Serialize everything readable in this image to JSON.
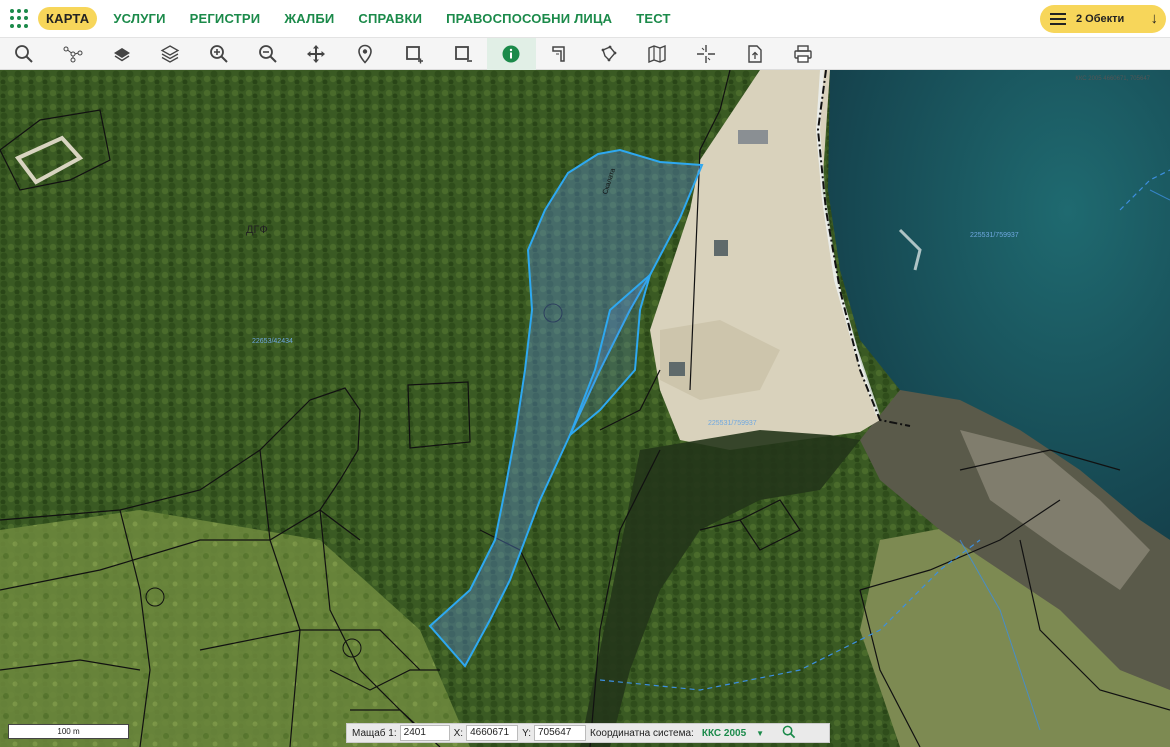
{
  "nav": {
    "items": [
      "КАРТА",
      "УСЛУГИ",
      "РЕГИСТРИ",
      "ЖАЛБИ",
      "СПРАВКИ",
      "ПРАВОСПОСОБНИ ЛИЦА",
      "ТЕСТ"
    ],
    "active_index": 0,
    "objects_label": "2 Обекти"
  },
  "toolbar": {
    "tools": [
      "search-icon",
      "measure-network-icon",
      "layer-icon",
      "layers-icon",
      "zoom-in-icon",
      "zoom-out-icon",
      "pan-icon",
      "location-pin-icon",
      "select-add-icon",
      "select-remove-icon",
      "info-icon",
      "bookmark-icon",
      "polygon-tool-icon",
      "map-icon",
      "crosshair-icon",
      "export-icon",
      "print-icon"
    ],
    "active_index": 10
  },
  "map": {
    "corner_text": "ККС 2005 4660671, 705647",
    "labels": {
      "forest": "ДГФ",
      "parcel_ref_1": "22653/42434",
      "parcel_ref_2": "225531/759937",
      "parcel_ref_3": "225531/759937",
      "skalata": "Скалата"
    }
  },
  "scale_bar": "100 m",
  "coordinates": {
    "scale_label": "Мащаб 1:",
    "scale_value": "2401",
    "x_label": "X:",
    "x_value": "4660671",
    "y_label": "Y:",
    "y_value": "705647",
    "crs_label": "Координатна система:",
    "crs_value": "ККС 2005"
  },
  "colors": {
    "brand_green": "#1b8a4a",
    "accent_yellow": "#f7d65a",
    "selection_blue": "#2ea8f0"
  }
}
